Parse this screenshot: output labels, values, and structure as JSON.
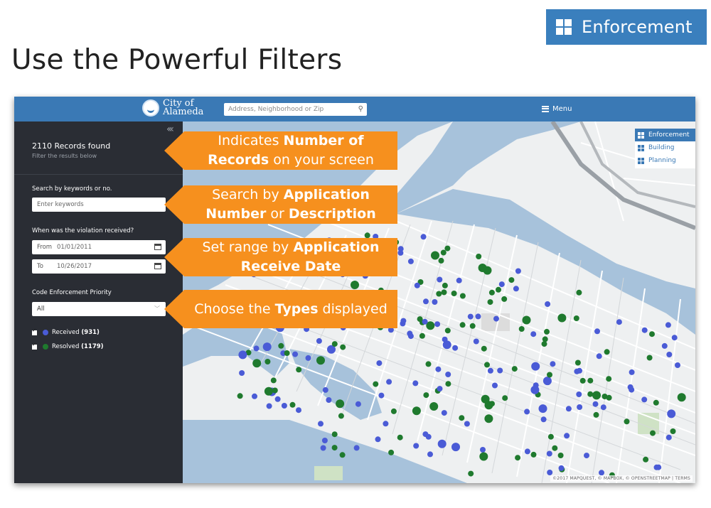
{
  "slide": {
    "badge_label": "Enforcement",
    "title": "Use the Powerful Filters"
  },
  "app": {
    "logo_line1": "City of",
    "logo_line2": "Alameda",
    "search_placeholder": "Address, Neighborhood or Zip",
    "menu_label": "Menu"
  },
  "sidebar": {
    "records_found": "2110 Records found",
    "filter_hint": "Filter the results below",
    "keyword_label": "Search by keywords or no.",
    "keyword_placeholder": "Enter keywords",
    "date_label": "When was the violation received?",
    "from_label": "From",
    "from_value": "01/01/2011",
    "to_label": "To",
    "to_value": "10/26/2017",
    "priority_label": "Code Enforcement Priority",
    "priority_value": "All",
    "legend": [
      {
        "label": "Received",
        "count": "(931)",
        "color": "#4a5bd6"
      },
      {
        "label": "Resolved",
        "count": "(1179)",
        "color": "#1f7a2e"
      }
    ]
  },
  "layers": [
    {
      "label": "Enforcement",
      "active": true
    },
    {
      "label": "Building",
      "active": false
    },
    {
      "label": "Planning",
      "active": false
    }
  ],
  "map": {
    "attribution": "©2017 MAPQUEST, © MAPBOX, © OPENSTREETMAP | TERMS",
    "water_color": "#a7c2db",
    "land_color": "#eef0f1"
  },
  "callouts": [
    {
      "pre": "Indicates ",
      "bold1": "Number of",
      "mid": "",
      "bold2": "Records",
      "post": " on your screen"
    },
    {
      "pre": "Search by ",
      "bold1": "Application",
      "mid": "",
      "bold2": "Number",
      "post2": " or ",
      "bold3": "Description"
    },
    {
      "pre": "Set range by ",
      "bold1": "Application",
      "mid": "",
      "bold2": "Receive Date"
    },
    {
      "pre": "Choose the ",
      "bold1": "Types",
      "post": " displayed"
    }
  ]
}
